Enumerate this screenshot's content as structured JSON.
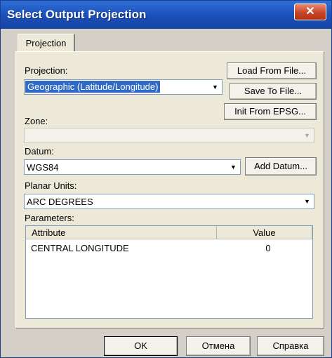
{
  "window": {
    "title": "Select Output Projection",
    "close_glyph": "✕"
  },
  "tabs": [
    {
      "label": "Projection",
      "active": true
    }
  ],
  "projection": {
    "label": "Projection:",
    "value": "Geographic (Latitude/Longitude)"
  },
  "zone": {
    "label": "Zone:",
    "value": "",
    "disabled": true
  },
  "datum": {
    "label": "Datum:",
    "value": "WGS84"
  },
  "planar_units": {
    "label": "Planar Units:",
    "value": "ARC DEGREES"
  },
  "parameters": {
    "label": "Parameters:",
    "columns": [
      "Attribute",
      "Value"
    ],
    "rows": [
      {
        "attribute": "CENTRAL LONGITUDE",
        "value": "0"
      }
    ]
  },
  "buttons": {
    "load_from_file": "Load From File...",
    "save_to_file": "Save To File...",
    "init_from_epsg": "Init From EPSG...",
    "add_datum": "Add Datum...",
    "ok": "OK",
    "cancel": "Отмена",
    "help": "Справка"
  },
  "icons": {
    "dropdown_arrow": "▼",
    "close": "close-icon"
  },
  "colors": {
    "titlebar": "#1a4fb8",
    "selection": "#316ac5",
    "close_button": "#c6452a"
  }
}
